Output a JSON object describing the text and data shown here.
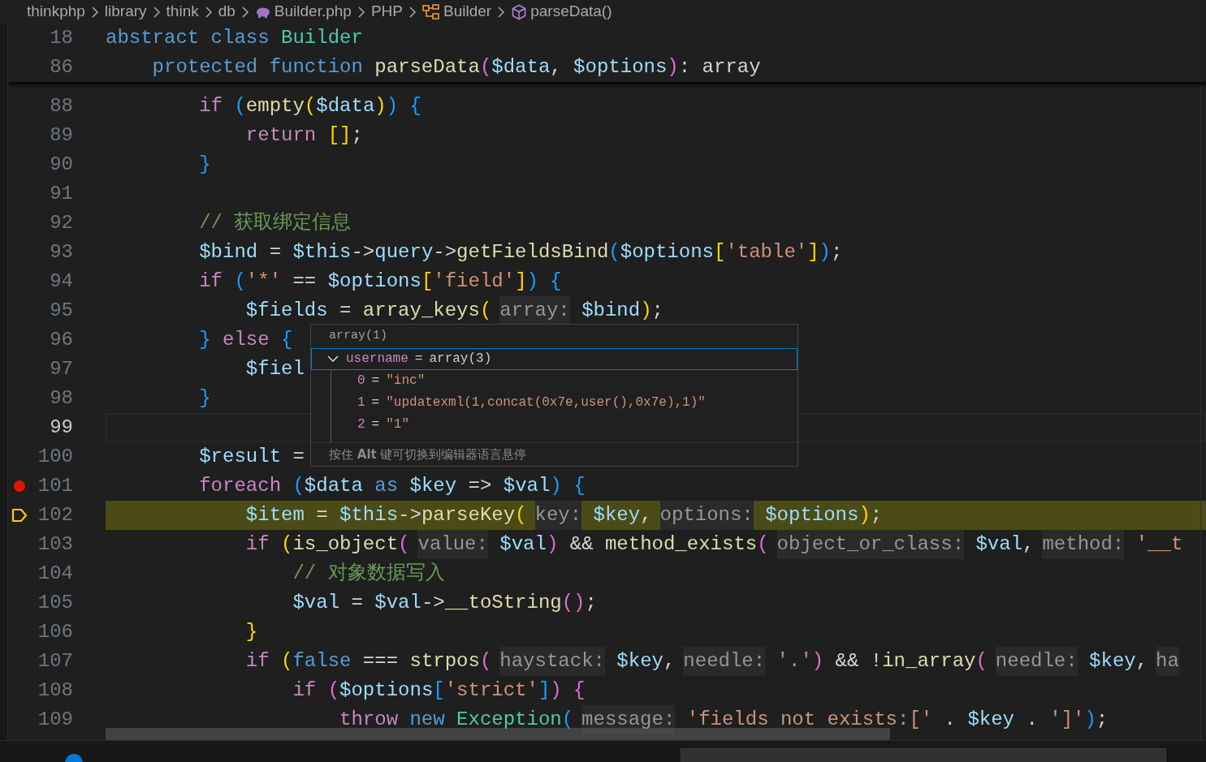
{
  "breadcrumb": [
    {
      "label": "thinkphp",
      "kind": "folder"
    },
    {
      "label": "library",
      "kind": "folder"
    },
    {
      "label": "think",
      "kind": "folder"
    },
    {
      "label": "db",
      "kind": "folder"
    },
    {
      "label": "Builder.php",
      "kind": "php-file"
    },
    {
      "label": "PHP",
      "kind": "folder"
    },
    {
      "label": "Builder",
      "kind": "class"
    },
    {
      "label": "parseData()",
      "kind": "method"
    }
  ],
  "sticky_scroll": [
    {
      "number": "18",
      "tokens": [
        {
          "kind": "kw",
          "text": "abstract"
        },
        {
          "kind": "kw",
          "text": " class"
        },
        {
          "kind": "cls",
          "text": " Builder"
        }
      ]
    },
    {
      "number": "86",
      "tokens": [
        {
          "kind": "kw",
          "text": "    protected"
        },
        {
          "kind": "kw",
          "text": " function"
        },
        {
          "kind": "fn",
          "text": " parseData"
        },
        {
          "kind": "b2",
          "text": "("
        },
        {
          "kind": "var",
          "text": "$data"
        },
        {
          "kind": "p",
          "text": ","
        },
        {
          "kind": "var",
          "text": " $options"
        },
        {
          "kind": "b2",
          "text": ")"
        },
        {
          "kind": "p",
          "text": ": array"
        }
      ]
    }
  ],
  "lines": [
    {
      "number": "88",
      "current": false,
      "breakpoint": false,
      "paused": false,
      "tokens": [
        {
          "kind": "ctrl",
          "text": "        if"
        },
        {
          "kind": "b3",
          "text": " ("
        },
        {
          "kind": "fn",
          "text": "empty"
        },
        {
          "kind": "b1",
          "text": "("
        },
        {
          "kind": "var",
          "text": "$data"
        },
        {
          "kind": "b1",
          "text": ")"
        },
        {
          "kind": "b3",
          "text": ")"
        },
        {
          "kind": "b3",
          "text": " {"
        }
      ]
    },
    {
      "number": "89",
      "current": false,
      "breakpoint": false,
      "paused": false,
      "tokens": [
        {
          "kind": "ctrl",
          "text": "            return"
        },
        {
          "kind": "b1",
          "text": " []"
        },
        {
          "kind": "p",
          "text": ";"
        }
      ]
    },
    {
      "number": "90",
      "current": false,
      "breakpoint": false,
      "paused": false,
      "tokens": [
        {
          "kind": "b3",
          "text": "        }"
        }
      ]
    },
    {
      "number": "91",
      "current": false,
      "breakpoint": false,
      "paused": false
    },
    {
      "number": "92",
      "current": false,
      "breakpoint": false,
      "paused": false,
      "tokens": [
        {
          "kind": "cmt",
          "text": "        // 获取绑定信息"
        }
      ]
    },
    {
      "number": "93",
      "current": false,
      "breakpoint": false,
      "paused": false,
      "tokens": [
        {
          "kind": "var",
          "text": "        $bind"
        },
        {
          "kind": "p",
          "text": " ="
        },
        {
          "kind": "var",
          "text": " $this"
        },
        {
          "kind": "p",
          "text": "->"
        },
        {
          "kind": "var",
          "text": "query"
        },
        {
          "kind": "p",
          "text": "->"
        },
        {
          "kind": "fn",
          "text": "getFieldsBind"
        },
        {
          "kind": "b3",
          "text": "("
        },
        {
          "kind": "var",
          "text": "$options"
        },
        {
          "kind": "b1",
          "text": "["
        },
        {
          "kind": "str",
          "text": "'table'"
        },
        {
          "kind": "b1",
          "text": "]"
        },
        {
          "kind": "b3",
          "text": ")"
        },
        {
          "kind": "p",
          "text": ";"
        }
      ]
    },
    {
      "number": "94",
      "current": false,
      "breakpoint": false,
      "paused": false,
      "tokens": [
        {
          "kind": "ctrl",
          "text": "        if"
        },
        {
          "kind": "b3",
          "text": " ("
        },
        {
          "kind": "str",
          "text": "'*'"
        },
        {
          "kind": "p",
          "text": " =="
        },
        {
          "kind": "var",
          "text": " $options"
        },
        {
          "kind": "b1",
          "text": "["
        },
        {
          "kind": "str",
          "text": "'field'"
        },
        {
          "kind": "b1",
          "text": "]"
        },
        {
          "kind": "b3",
          "text": ")"
        },
        {
          "kind": "b3",
          "text": " {"
        }
      ]
    },
    {
      "number": "95",
      "current": false,
      "breakpoint": false,
      "paused": false,
      "tokens": [
        {
          "kind": "var",
          "text": "            $fields"
        },
        {
          "kind": "p",
          "text": " ="
        },
        {
          "kind": "fn",
          "text": " array_keys"
        },
        {
          "kind": "b1",
          "text": "("
        },
        {
          "kind": "hint",
          "text": "array:"
        },
        {
          "kind": "var",
          "text": " $bind"
        },
        {
          "kind": "b1",
          "text": ")"
        },
        {
          "kind": "p",
          "text": ";"
        }
      ]
    },
    {
      "number": "96",
      "current": false,
      "breakpoint": false,
      "paused": false,
      "tokens": [
        {
          "kind": "b3",
          "text": "        }"
        },
        {
          "kind": "ctrl",
          "text": " else"
        },
        {
          "kind": "b3",
          "text": " {"
        }
      ]
    },
    {
      "number": "97",
      "current": false,
      "breakpoint": false,
      "paused": false,
      "tokens": [
        {
          "kind": "var",
          "text": "            $fiel"
        }
      ]
    },
    {
      "number": "98",
      "current": false,
      "breakpoint": false,
      "paused": false,
      "tokens": [
        {
          "kind": "b3",
          "text": "        }"
        }
      ]
    },
    {
      "number": "99",
      "current": true,
      "breakpoint": false,
      "paused": false
    },
    {
      "number": "100",
      "current": false,
      "breakpoint": false,
      "paused": false,
      "tokens": [
        {
          "kind": "var",
          "text": "        $result"
        },
        {
          "kind": "p",
          "text": " ="
        }
      ]
    },
    {
      "number": "101",
      "current": false,
      "breakpoint": true,
      "paused": false,
      "tokens": [
        {
          "kind": "ctrl",
          "text": "        foreach"
        },
        {
          "kind": "b3",
          "text": " ("
        },
        {
          "kind": "var",
          "text": "$data"
        },
        {
          "kind": "kw",
          "text": " as"
        },
        {
          "kind": "var",
          "text": " $key"
        },
        {
          "kind": "p",
          "text": " =>"
        },
        {
          "kind": "var",
          "text": " $val"
        },
        {
          "kind": "b3",
          "text": ")"
        },
        {
          "kind": "b3",
          "text": " {"
        }
      ]
    },
    {
      "number": "102",
      "current": false,
      "breakpoint": false,
      "paused": true,
      "tokens": [
        {
          "kind": "var",
          "text": "            $item"
        },
        {
          "kind": "p",
          "text": " ="
        },
        {
          "kind": "var",
          "text": " $this"
        },
        {
          "kind": "p",
          "text": "->"
        },
        {
          "kind": "fn",
          "text": "parseKey"
        },
        {
          "kind": "b1",
          "text": "("
        },
        {
          "kind": "hint",
          "text": "key:"
        },
        {
          "kind": "var",
          "text": " $key"
        },
        {
          "kind": "p",
          "text": ","
        },
        {
          "kind": "hint",
          "text": "options:"
        },
        {
          "kind": "var",
          "text": " $options"
        },
        {
          "kind": "b1",
          "text": ")"
        },
        {
          "kind": "p",
          "text": ";"
        }
      ]
    },
    {
      "number": "103",
      "current": false,
      "breakpoint": false,
      "paused": false,
      "tokens": [
        {
          "kind": "ctrl",
          "text": "            if"
        },
        {
          "kind": "b1",
          "text": " ("
        },
        {
          "kind": "fn",
          "text": "is_object"
        },
        {
          "kind": "b2",
          "text": "("
        },
        {
          "kind": "hint",
          "text": "value:"
        },
        {
          "kind": "var",
          "text": " $val"
        },
        {
          "kind": "b2",
          "text": ")"
        },
        {
          "kind": "p",
          "text": " &&"
        },
        {
          "kind": "fn",
          "text": " method_exists"
        },
        {
          "kind": "b2",
          "text": "("
        },
        {
          "kind": "hint",
          "text": "object_or_class:"
        },
        {
          "kind": "var",
          "text": " $val"
        },
        {
          "kind": "p",
          "text": ","
        },
        {
          "kind": "hint",
          "text": "method:"
        },
        {
          "kind": "str",
          "text": " '__t"
        }
      ]
    },
    {
      "number": "104",
      "current": false,
      "breakpoint": false,
      "paused": false,
      "tokens": [
        {
          "kind": "cmt",
          "text": "                // 对象数据写入"
        }
      ]
    },
    {
      "number": "105",
      "current": false,
      "breakpoint": false,
      "paused": false,
      "tokens": [
        {
          "kind": "var",
          "text": "                $val"
        },
        {
          "kind": "p",
          "text": " ="
        },
        {
          "kind": "var",
          "text": " $val"
        },
        {
          "kind": "p",
          "text": "->"
        },
        {
          "kind": "fn",
          "text": "__toString"
        },
        {
          "kind": "b2",
          "text": "()"
        },
        {
          "kind": "p",
          "text": ";"
        }
      ]
    },
    {
      "number": "106",
      "current": false,
      "breakpoint": false,
      "paused": false,
      "tokens": [
        {
          "kind": "b1",
          "text": "            }"
        }
      ]
    },
    {
      "number": "107",
      "current": false,
      "breakpoint": false,
      "paused": false,
      "tokens": [
        {
          "kind": "ctrl",
          "text": "            if"
        },
        {
          "kind": "b1",
          "text": " ("
        },
        {
          "kind": "kw",
          "text": "false"
        },
        {
          "kind": "p",
          "text": " ==="
        },
        {
          "kind": "fn",
          "text": " strpos"
        },
        {
          "kind": "b2",
          "text": "("
        },
        {
          "kind": "hint",
          "text": "haystack:"
        },
        {
          "kind": "var",
          "text": " $key"
        },
        {
          "kind": "p",
          "text": ","
        },
        {
          "kind": "hint",
          "text": "needle:"
        },
        {
          "kind": "str",
          "text": " '.'"
        },
        {
          "kind": "b2",
          "text": ")"
        },
        {
          "kind": "p",
          "text": " && !"
        },
        {
          "kind": "fn",
          "text": "in_array"
        },
        {
          "kind": "b2",
          "text": "("
        },
        {
          "kind": "hint",
          "text": "needle:"
        },
        {
          "kind": "var",
          "text": " $key"
        },
        {
          "kind": "p",
          "text": ","
        },
        {
          "kind": "hint",
          "text": "ha"
        }
      ]
    },
    {
      "number": "108",
      "current": false,
      "breakpoint": false,
      "paused": false,
      "tokens": [
        {
          "kind": "ctrl",
          "text": "                if"
        },
        {
          "kind": "b2",
          "text": " ("
        },
        {
          "kind": "var",
          "text": "$options"
        },
        {
          "kind": "b3",
          "text": "["
        },
        {
          "kind": "str",
          "text": "'strict'"
        },
        {
          "kind": "b3",
          "text": "]"
        },
        {
          "kind": "b2",
          "text": ")"
        },
        {
          "kind": "b2",
          "text": " {"
        }
      ]
    },
    {
      "number": "109",
      "current": false,
      "breakpoint": false,
      "paused": false,
      "tokens": [
        {
          "kind": "ctrl",
          "text": "                    throw"
        },
        {
          "kind": "kw",
          "text": " new"
        },
        {
          "kind": "cls",
          "text": " Exception"
        },
        {
          "kind": "b3",
          "text": "("
        },
        {
          "kind": "hint",
          "text": "message:"
        },
        {
          "kind": "str",
          "text": " 'fields not exists:['"
        },
        {
          "kind": "p",
          "text": " ."
        },
        {
          "kind": "var",
          "text": " $key"
        },
        {
          "kind": "p",
          "text": " ."
        },
        {
          "kind": "str",
          "text": " ']'"
        },
        {
          "kind": "b3",
          "text": ")"
        },
        {
          "kind": "p",
          "text": ";"
        }
      ]
    }
  ],
  "hover": {
    "header": "array(1)",
    "tree": [
      {
        "key": "username",
        "op": "=",
        "value": "array(3)",
        "expanded": true,
        "selected": true,
        "children": [
          {
            "key": "0",
            "op": "=",
            "value": "\"inc\""
          },
          {
            "key": "1",
            "op": "=",
            "value": "\"updatexml(1,concat(0x7e,user(),0x7e),1)\""
          },
          {
            "key": "2",
            "op": "=",
            "value": "\"1\""
          }
        ]
      }
    ],
    "footer": "按住 **Alt** 键可切换到编辑器语言悬停"
  }
}
